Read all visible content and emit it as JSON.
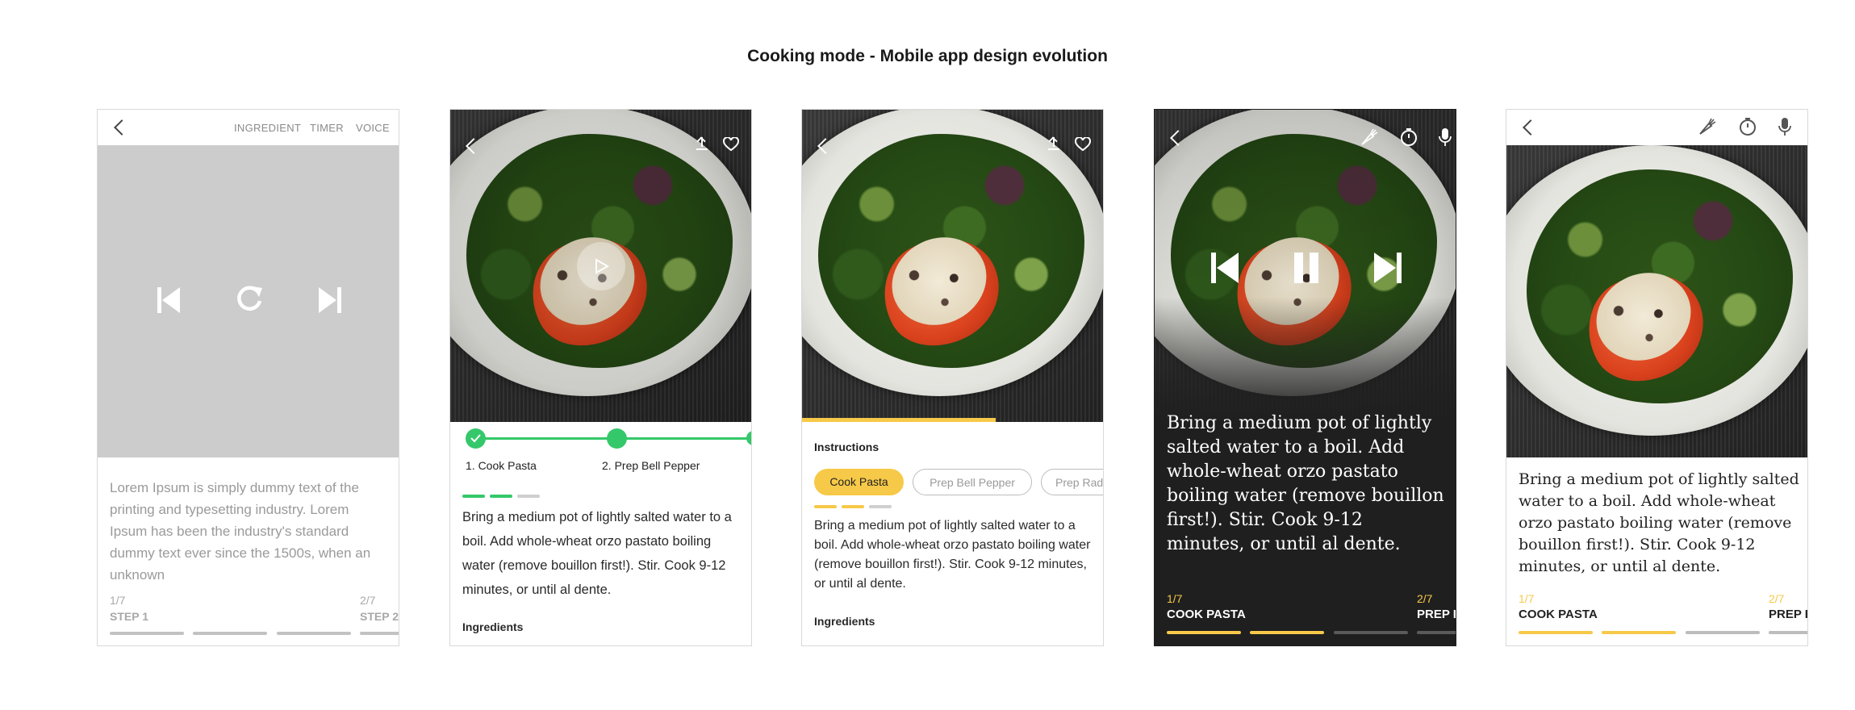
{
  "page_title": "Cooking mode - Mobile app design evolution",
  "colors": {
    "accent_yellow": "#f7c948",
    "accent_green": "#34c86a",
    "dark_panel": "#1f1f1f",
    "grey_media": "#cccccc"
  },
  "frame1": {
    "tabs": [
      "INGREDIENT",
      "TIMER",
      "VOICE"
    ],
    "body_text": "Lorem Ipsum is simply dummy text of the printing and typesetting industry. Lorem Ipsum has been the industry's standard dummy text ever since the 1500s, when an unknown",
    "steps": [
      {
        "num": "1/7",
        "name": "STEP 1"
      },
      {
        "num": "2/7",
        "name": "STEP 2"
      }
    ]
  },
  "frame2": {
    "steps": [
      "1. Cook Pasta",
      "2. Prep Bell Pepper"
    ],
    "body_text": "Bring a medium pot of lightly salted water to a boil. Add whole-wheat orzo pastato boiling water (remove bouillon first!). Stir. Cook 9-12 minutes, or until al dente.",
    "ingredients_label": "Ingredients"
  },
  "frame3": {
    "instructions_label": "Instructions",
    "pills": [
      "Cook Pasta",
      "Prep Bell Pepper",
      "Prep Radi"
    ],
    "body_text": "Bring a medium pot of lightly salted water to a boil. Add whole-wheat orzo pastato boiling water (remove bouillon first!). Stir. Cook 9-12 minutes, or until al dente.",
    "ingredients_label": "Ingredients"
  },
  "frame4": {
    "body_text": "Bring a medium pot of lightly salted water to a boil. Add whole-wheat orzo pastato boiling water (remove bouillon first!). Stir. Cook 9-12 minutes, or until al dente.",
    "steps": [
      {
        "num": "1/7",
        "name": "COOK PASTA"
      },
      {
        "num": "2/7",
        "name": "PREP BE"
      }
    ]
  },
  "frame5": {
    "body_text": "Bring a medium pot of lightly salted water to a boil. Add whole-wheat orzo pastato boiling water (remove bouillon first!). Stir. Cook 9-12 minutes, or until al dente.",
    "steps": [
      {
        "num": "1/7",
        "name": "COOK PASTA"
      },
      {
        "num": "2/7",
        "name": "PREP BE"
      }
    ]
  }
}
